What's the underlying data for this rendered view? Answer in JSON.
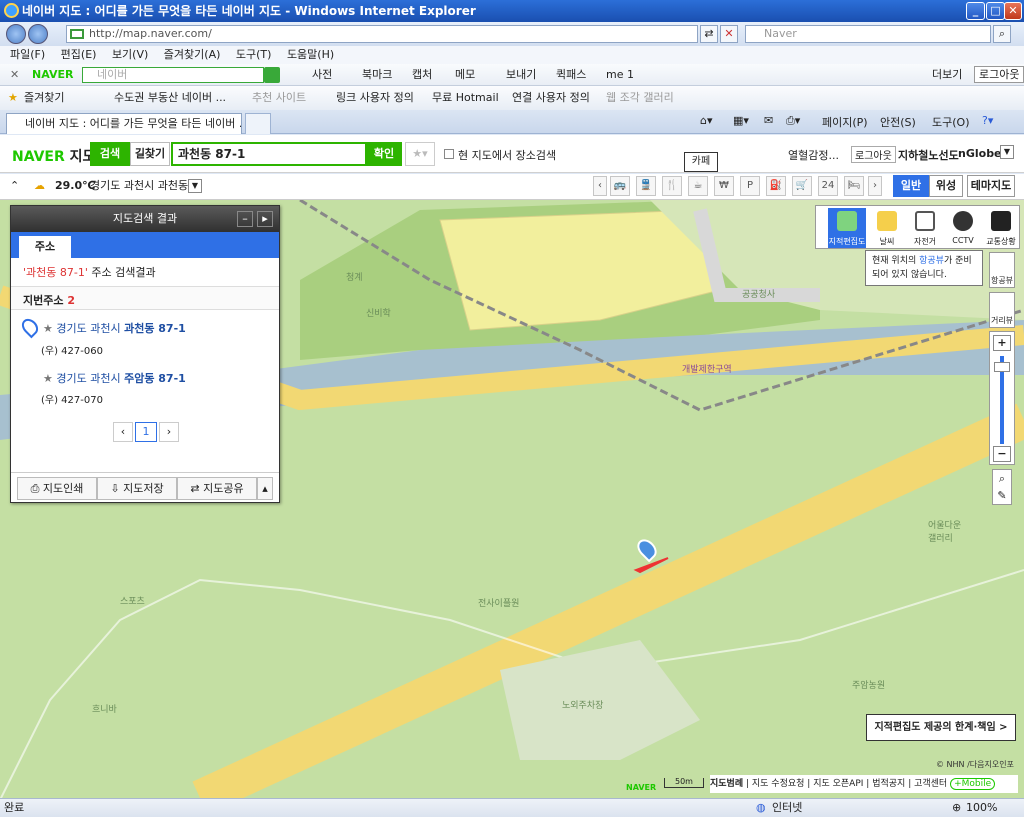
{
  "window": {
    "title": "네이버 지도 : 어디를 가든 무엇을 타든 네이버 지도 - Windows Internet Explorer"
  },
  "browser": {
    "url": "http://map.naver.com/",
    "search_placeholder": "Naver",
    "menu": [
      "파일(F)",
      "편집(E)",
      "보기(V)",
      "즐겨찾기(A)",
      "도구(T)",
      "도움말(H)"
    ],
    "naver_toolbar": {
      "brand": "NAVER",
      "search_placeholder": "네이버",
      "items": [
        "사전",
        "북마크",
        "캡처",
        "메모",
        "보내기",
        "퀵패스",
        "me 1"
      ],
      "right": [
        "더보기",
        "로그아웃"
      ]
    },
    "favorites": {
      "label": "즐겨찾기",
      "items": [
        "수도권 부동산 네이버 ...",
        "추천 사이트",
        "링크 사용자 정의",
        "무료 Hotmail",
        "연결 사용자 정의",
        "웹 조각 갤러리"
      ]
    },
    "tab": {
      "label": "네이버 지도 : 어디를 가든 무엇을 타든 네이버 ..."
    },
    "command_bar": [
      "페이지(P)",
      "안전(S)",
      "도구(O)"
    ]
  },
  "map_header": {
    "brand_naver": "NAVER",
    "brand_map": "지도",
    "search_tab": "검색",
    "route_tab": "길찾기",
    "query": "과천동 87-1",
    "confirm": "확인",
    "in_map_search": "현 지도에서 장소검색",
    "recent": "열혈감정...",
    "logout": "로그아웃",
    "subway": "지하철노선도",
    "nglobe": "nGlobe"
  },
  "weather": {
    "temp": "29.0℃",
    "location": "경기도 과천시 과천동"
  },
  "categories": {
    "tooltip": "카페",
    "items": [
      "bus-icon",
      "train-icon",
      "restaurant-icon",
      "cafe-icon",
      "bank-icon",
      "parking-icon",
      "gas-icon",
      "shopping-icon",
      "24h-icon",
      "hotel-icon"
    ]
  },
  "map_types": [
    "일반",
    "위성",
    "테마지도"
  ],
  "map_tools": {
    "items": [
      "지적편집도",
      "날씨",
      "자전거",
      "CCTV",
      "교통상황"
    ],
    "tooltip_pre": "현재 위치의 ",
    "tooltip_link": "항공뷰",
    "tooltip_post": "가 준비되어 있지 않습니다.",
    "aerial": "항공뷰",
    "street": "거리뷰"
  },
  "results": {
    "title": "지도검색 결과",
    "tab": "주소",
    "summary_query": "'과천동 87-1'",
    "summary_text": " 주소 검색결과",
    "section": "지번주소",
    "count": "2",
    "items": [
      {
        "prefix": "경기도 과천시 ",
        "name": "과천동 87-1",
        "zip": "(우) 427-060"
      },
      {
        "prefix": "경기도 과천시 ",
        "name": "주암동 87-1",
        "zip": "(우) 427-070"
      }
    ],
    "page": "1",
    "actions": [
      "지도인쇄",
      "지도저장",
      "지도공유"
    ]
  },
  "map_labels": [
    "공공청사",
    "개발제한구역",
    "어울다운 갤러리",
    "노외주차장",
    "주암농원",
    "청계",
    "스포츠",
    "흐니바",
    "신비학",
    "전사이플원"
  ],
  "notice": "지적편집도 제공의 한계·책임 >",
  "footer": {
    "scale": "50m",
    "links": [
      "지도범례",
      "지도 수정요청",
      "지도 오픈API",
      "법적공지",
      "고객센터"
    ],
    "mobile": "+Mobile",
    "copyright": "© NHN /다음지오인포"
  },
  "status": {
    "left": "완료",
    "zone": "인터넷",
    "zoom": "100%"
  }
}
